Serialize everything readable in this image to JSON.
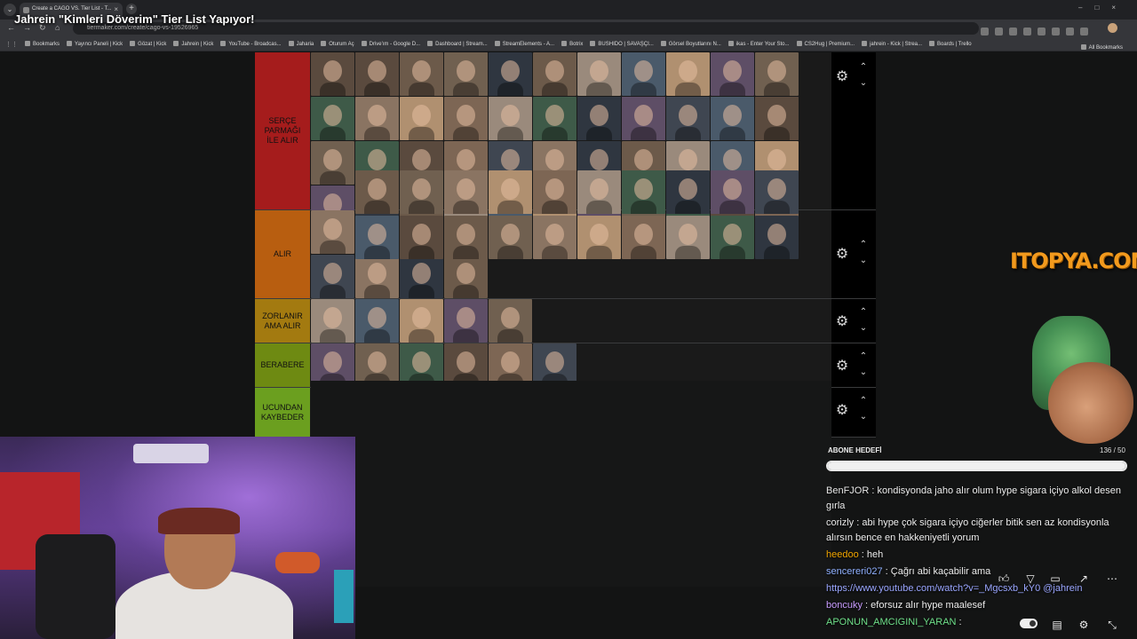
{
  "browser": {
    "tab_title": "Create a CAGO VS. Tier List - T...",
    "url": "tiermaker.com/create/cago-vs-19526965",
    "bookmarks": [
      "Bookmarks",
      "Yayıncı Paneli | Kick",
      "Gözat | Kick",
      "Jahrein | Kick",
      "YouTube - Broadcas...",
      "Jaharia",
      "Oturum Aç",
      "Drive'ım - Google D...",
      "Dashboard | Stream...",
      "StreamElements - A...",
      "Botrix",
      "BUSHIDO | SAVAŞÇI...",
      "Görsel Boyutlarını N...",
      "ikas - Enter Your Sto...",
      "CS2Hug | Premium...",
      "jahrein - Kick | Strea...",
      "Boards | Trello"
    ],
    "all_bookmarks": "All Bookmarks"
  },
  "stream_title": "Jahrein \"Kimleri Döverim\" Tier List Yapıyor!",
  "tiers": [
    {
      "label": "SERÇE PARMAĞI İLE ALIR",
      "color": "#a51c1c"
    },
    {
      "label": "ALIR",
      "color": "#b85e10"
    },
    {
      "label": "ZORLANIR AMA ALIR",
      "color": "#a37a10"
    },
    {
      "label": "BERABERE",
      "color": "#6e8a12"
    },
    {
      "label": "UCUNDAN KAYBEDER",
      "color": "#6b9f1f"
    }
  ],
  "logo": "ITOPYA.COM",
  "sub_goal": {
    "label": "ABONE HEDEFİ",
    "current": 136,
    "target": 50,
    "count_text": "136 / 50"
  },
  "chat": [
    {
      "user": "BenFJOR",
      "user_color": "#e8e8e8",
      "text": " : kondisyonda jaho alır olum hype sigara içiyo alkol desen gırla"
    },
    {
      "user": "corizly",
      "user_color": "#e8e8e8",
      "text": " : abi hype çok sigara içiyo ciğerler bitik sen az kondisyonla alırsın bence en hakkeniyetli yorum"
    },
    {
      "user": "heedoo",
      "user_color": "#f0a500",
      "text": " : heh"
    },
    {
      "user": "sencereri027",
      "user_color": "#8fb0ff",
      "text": " : Çağrı abi kaçabilir ama"
    },
    {
      "user": "",
      "user_color": "#9aa6ff",
      "text": "https://www.youtube.com/watch?v=_Mgcsxb_kY0 @jahrein"
    },
    {
      "user": "boncuky",
      "user_color": "#c89cff",
      "text": " : eforsuz alır hype maalesef"
    },
    {
      "user": "APONUN_AMCIGINI_YARAN",
      "user_color": "#6fe08a",
      "text": " : "
    }
  ],
  "icons": {
    "settings": "gear-icon",
    "up": "chevron-up-icon",
    "down": "chevron-down-icon"
  }
}
